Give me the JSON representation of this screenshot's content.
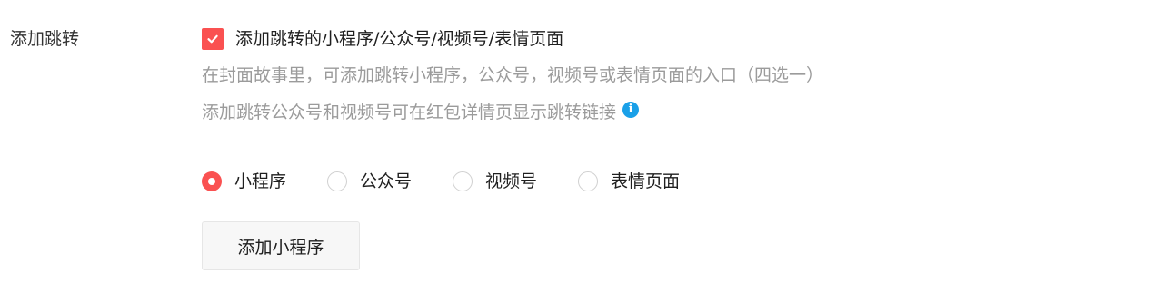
{
  "row_label": "添加跳转",
  "checkbox": {
    "checked": true,
    "label": "添加跳转的小程序/公众号/视频号/表情页面"
  },
  "descriptions": {
    "line1": "在封面故事里，可添加跳转小程序，公众号，视频号或表情页面的入口（四选一）",
    "line2": "添加跳转公众号和视频号可在红包详情页显示跳转链接",
    "info_icon_glyph": "i"
  },
  "radio_options": [
    {
      "label": "小程序",
      "selected": true
    },
    {
      "label": "公众号",
      "selected": false
    },
    {
      "label": "视频号",
      "selected": false
    },
    {
      "label": "表情页面",
      "selected": false
    }
  ],
  "add_button_label": "添加小程序",
  "colors": {
    "accent": "#fa5151",
    "info": "#1aa0e8",
    "muted_text": "#9b9b9b"
  }
}
